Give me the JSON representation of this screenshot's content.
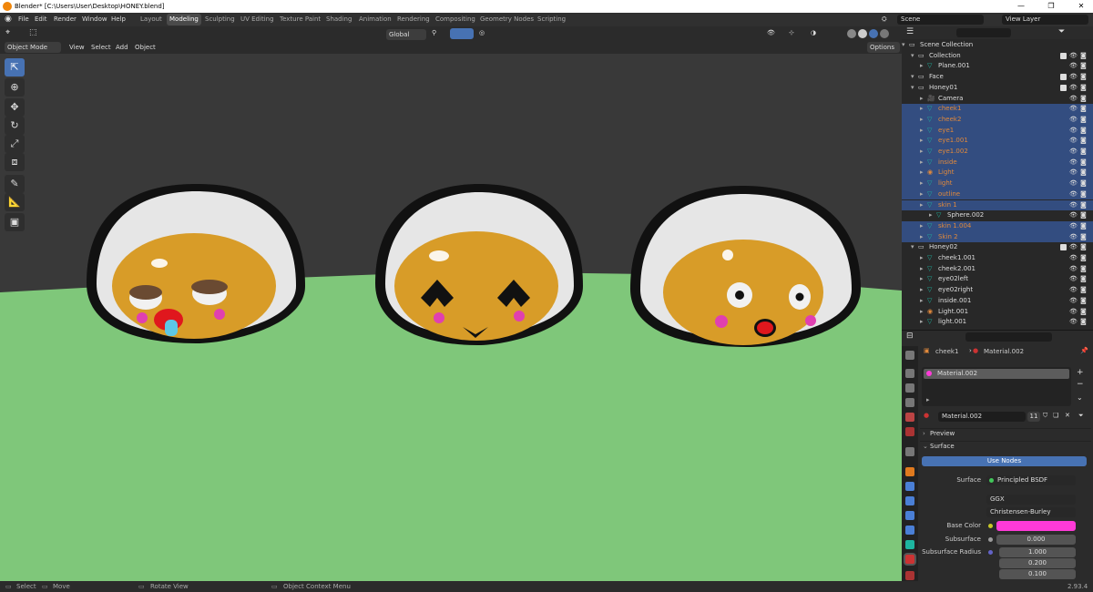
{
  "window": {
    "title": "Blender* [C:\\Users\\User\\Desktop\\HONEY.blend]",
    "min": "—",
    "max": "❐",
    "close": "✕"
  },
  "menu": [
    "File",
    "Edit",
    "Render",
    "Window",
    "Help"
  ],
  "workspaces": [
    "Layout",
    "Modeling",
    "Sculpting",
    "UV Editing",
    "Texture Paint",
    "Shading",
    "Animation",
    "Rendering",
    "Compositing",
    "Geometry Nodes",
    "Scripting"
  ],
  "active_workspace": "Modeling",
  "scene": {
    "label": "Scene",
    "view_layer": "View Layer"
  },
  "viewport": {
    "mode": "Object Mode",
    "menus": [
      "View",
      "Select",
      "Add",
      "Object"
    ],
    "orientation": "Global",
    "options": "Options"
  },
  "outliner": {
    "rows": [
      {
        "label": "Scene Collection",
        "indent": 0,
        "type": "root"
      },
      {
        "label": "Collection",
        "indent": 1,
        "type": "coll",
        "chk": true
      },
      {
        "label": "Plane.001",
        "indent": 2,
        "type": "mesh"
      },
      {
        "label": "Face",
        "indent": 1,
        "type": "coll",
        "chk": true
      },
      {
        "label": "Honey01",
        "indent": 1,
        "type": "coll",
        "chk": true
      },
      {
        "label": "Camera",
        "indent": 2,
        "type": "cam"
      },
      {
        "label": "cheek1",
        "indent": 2,
        "type": "mesh",
        "hl": true,
        "orange": true
      },
      {
        "label": "cheek2",
        "indent": 2,
        "type": "mesh",
        "hl": true,
        "orange": true
      },
      {
        "label": "eye1",
        "indent": 2,
        "type": "mesh",
        "hl": true,
        "orange": true
      },
      {
        "label": "eye1.001",
        "indent": 2,
        "type": "mesh",
        "hl": true,
        "orange": true
      },
      {
        "label": "eye1.002",
        "indent": 2,
        "type": "mesh",
        "hl": true,
        "orange": true
      },
      {
        "label": "inside",
        "indent": 2,
        "type": "mesh",
        "hl": true,
        "orange": true
      },
      {
        "label": "Light",
        "indent": 2,
        "type": "light",
        "hl": true,
        "orange": true
      },
      {
        "label": "light",
        "indent": 2,
        "type": "mesh",
        "hl": true,
        "orange": true
      },
      {
        "label": "outline",
        "indent": 2,
        "type": "mesh",
        "hl": true,
        "orange": true
      },
      {
        "label": "skin 1",
        "indent": 2,
        "type": "mesh",
        "hl": true,
        "orange": true
      },
      {
        "label": "Sphere.002",
        "indent": 3,
        "type": "mesh"
      },
      {
        "label": "skin 1.004",
        "indent": 2,
        "type": "mesh",
        "hl": true,
        "orange": true
      },
      {
        "label": "Skin 2",
        "indent": 2,
        "type": "mesh",
        "hl": true,
        "orange": true
      },
      {
        "label": "Honey02",
        "indent": 1,
        "type": "coll",
        "chk": true
      },
      {
        "label": "cheek1.001",
        "indent": 2,
        "type": "mesh"
      },
      {
        "label": "cheek2.001",
        "indent": 2,
        "type": "mesh"
      },
      {
        "label": "eye02left",
        "indent": 2,
        "type": "mesh"
      },
      {
        "label": "eye02right",
        "indent": 2,
        "type": "mesh"
      },
      {
        "label": "inside.001",
        "indent": 2,
        "type": "mesh"
      },
      {
        "label": "Light.001",
        "indent": 2,
        "type": "light"
      },
      {
        "label": "light.001",
        "indent": 2,
        "type": "mesh"
      }
    ]
  },
  "properties": {
    "object": "cheek1",
    "material": "Material.002",
    "slot": "Material.002",
    "users": "11",
    "preview": "Preview",
    "surface_section": "Surface",
    "use_nodes": "Use Nodes",
    "surface_label": "Surface",
    "surface_value": "Principled BSDF",
    "distribution": "GGX",
    "subsurface_method": "Christensen-Burley",
    "base_color_label": "Base Color",
    "base_color": "#ff3ad8",
    "subsurface_label": "Subsurface",
    "subsurface_value": "0.000",
    "radius_label": "Subsurface Radius",
    "radius": [
      "1.000",
      "0.200",
      "0.100"
    ]
  },
  "status": {
    "select": "Select",
    "move": "Move",
    "rotate": "Rotate View",
    "context": "Object Context Menu",
    "version": "2.93.4"
  }
}
